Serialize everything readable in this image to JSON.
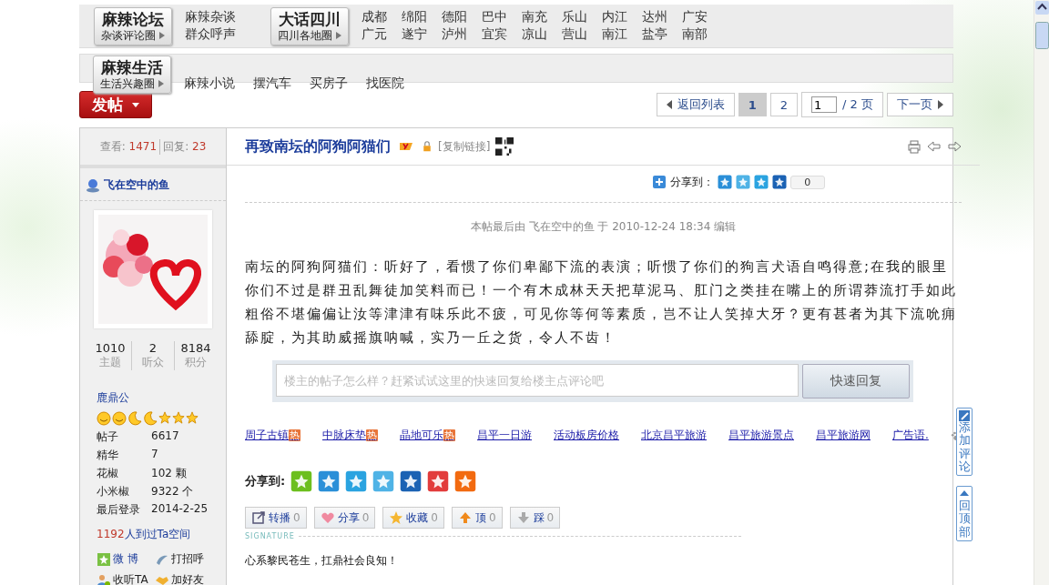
{
  "top_nav": {
    "groups": [
      {
        "title": "麻辣论坛",
        "subtitle": "杂谈评论圈",
        "links": [
          "麻辣杂谈",
          "群众呼声"
        ]
      },
      {
        "title": "大话四川",
        "subtitle": "四川各地圈",
        "links": [
          "成都",
          "绵阳",
          "德阳",
          "巴中",
          "南充",
          "乐山",
          "内江",
          "达州",
          "广安",
          "广元",
          "遂宁",
          "泸州",
          "宜宾",
          "凉山",
          "营山",
          "南江",
          "盐亭",
          "南部"
        ]
      }
    ]
  },
  "dropdown": {
    "title": "麻辣生活",
    "subtitle": "生活兴趣圈",
    "links": [
      "麻辣小说",
      "摆汽车",
      "买房子",
      "找医院"
    ]
  },
  "post_button": "发帖",
  "pagination": {
    "back": "返回列表",
    "pages": [
      {
        "label": "1",
        "selected": true
      },
      {
        "label": "2",
        "selected": false
      }
    ],
    "page_input": "1",
    "total": "/ 2 页",
    "next": "下一页"
  },
  "sidebar": {
    "views_label": "查看:",
    "views": "1471",
    "replies_label": "回复:",
    "replies": "23",
    "username": "飞在空中的鱼",
    "stats": [
      {
        "value": "1010",
        "label": "主题"
      },
      {
        "value": "2",
        "label": "听众"
      },
      {
        "value": "8184",
        "label": "积分"
      }
    ],
    "rank": "鹿鼎公",
    "profile": [
      {
        "label": "帖子",
        "value": "6617"
      },
      {
        "label": "精华",
        "value": "7"
      },
      {
        "label": "花椒",
        "value": "102 颗"
      },
      {
        "label": "小米椒",
        "value": "9322 个"
      },
      {
        "label": "最后登录",
        "value": "2014-2-25"
      }
    ],
    "visits": {
      "count": "1192",
      "text": "人到过Ta空间"
    },
    "actions": [
      "微 博",
      "打招呼",
      "收听TA",
      "加好友"
    ]
  },
  "post": {
    "title": "再致南坛的阿狗阿猫们",
    "copy_link": "[复制链接]",
    "share_label": "分享到：",
    "share_count": "0",
    "edited_note": "本帖最后由 飞在空中的鱼 于 2010-12-24 18:34 编辑",
    "body": "南坛的阿狗阿猫们：听好了，看惯了你们卑鄙下流的表演；听惯了你们的狗言犬语自鸣得意;在我的眼里你们不过是群丑乱舞徒加笑料而已！一个有木成林天天把草泥马、肛门之类挂在嘴上的所谓莽流打手如此粗俗不堪偏偏让汝等津津有味乐此不疲，可见你等何等素质，岂不让人笑掉大牙？更有甚者为其下流吮痈舔腚，为其助威摇旗呐喊，实乃一丘之货，令人不齿！",
    "reply_placeholder": "楼主的帖子怎么样？赶紧试试这里的快速回复给楼主点评论吧",
    "reply_button": "快速回复",
    "ad_links": [
      {
        "label": "周子古镇",
        "badge": "热"
      },
      {
        "label": "中脉床垫",
        "badge": "热"
      },
      {
        "label": "晶地可乐",
        "badge": "热"
      },
      {
        "label": "昌平一日游"
      },
      {
        "label": "活动板房价格"
      },
      {
        "label": "北京昌平旅游"
      },
      {
        "label": "昌平旅游景点"
      },
      {
        "label": "昌平旅游网"
      },
      {
        "label": "广告语."
      }
    ],
    "share_big_label": "分享到:",
    "actions": [
      {
        "label": "转播",
        "count": "0"
      },
      {
        "label": "分享",
        "count": "0"
      },
      {
        "label": "收藏",
        "count": "0"
      },
      {
        "label": "顶",
        "count": "0"
      },
      {
        "label": "踩",
        "count": "0"
      }
    ],
    "signature_label": "SIGNATURE",
    "signature": "心系黎民苍生，扛鼎社会良知！"
  },
  "side_tools": [
    "添加评论",
    "回顶部"
  ]
}
